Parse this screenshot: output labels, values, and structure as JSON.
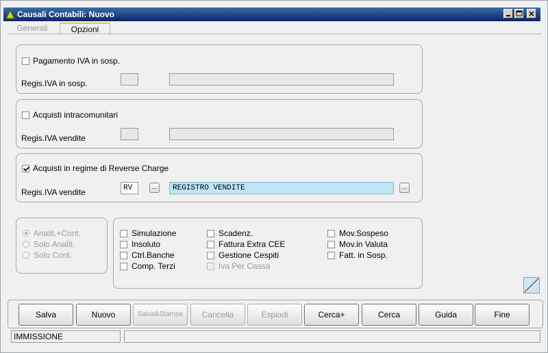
{
  "window": {
    "title": "Causali Contabili: Nuovo"
  },
  "tabs": [
    {
      "label": "Generali",
      "active": false
    },
    {
      "label": "Opzioni",
      "active": true
    }
  ],
  "group1": {
    "checkbox_label": "Pagamento IVA in sosp.",
    "checked": false,
    "field_label": "Regis.IVA in sosp.",
    "code": "",
    "description": ""
  },
  "group2": {
    "checkbox_label": "Acquisti intracomunitari",
    "checked": false,
    "field_label": "Regis.IVA vendite",
    "code": "",
    "description": ""
  },
  "group3": {
    "checkbox_label": "Acquisti in regime di Reverse Charge",
    "checked": true,
    "field_label": "Regis.IVA vendite",
    "code": "RV",
    "code_button": "...",
    "description": "REGISTRO VENDITE",
    "description_button": "..."
  },
  "radios": [
    {
      "label": "Analit.+Cont.",
      "selected": true
    },
    {
      "label": "Solo Analit.",
      "selected": false
    },
    {
      "label": "Solo Cont.",
      "selected": false
    }
  ],
  "options_col1": [
    "Simulazione",
    "Insoluto",
    "Ctrl.Banche",
    "Comp. Terzi"
  ],
  "options_col2": [
    "Scadenz.",
    "Fattura Extra CEE",
    "Gestione Cespiti",
    "Iva Per Cassa"
  ],
  "options_col3": [
    "Mov.Sospeso",
    "Mov.in Valuta",
    "Fatt. in Sosp."
  ],
  "buttons": {
    "salva": "Salva",
    "nuovo": "Nuovo",
    "salva_stampa": "Salva&Stampa",
    "cancella": "Cancella",
    "esplodi": "Esplodi",
    "cerca_plus": "Cerca+",
    "cerca": "Cerca",
    "guida": "Guida",
    "fine": "Fine"
  },
  "status": {
    "mode": "IMMISSIONE",
    "message": ""
  }
}
